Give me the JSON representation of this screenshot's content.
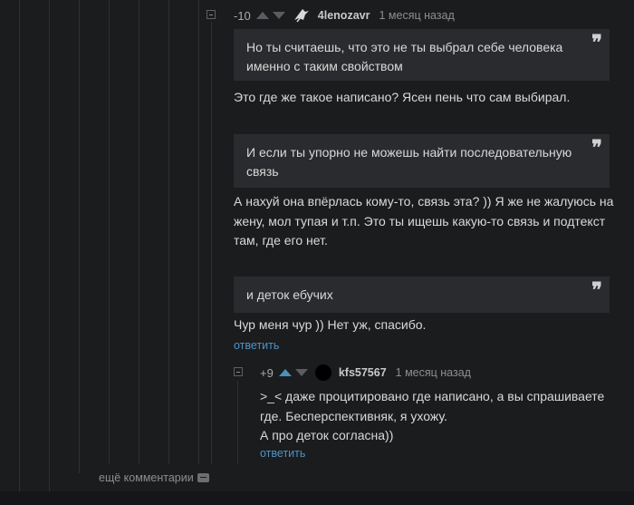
{
  "comment1": {
    "rating": "-10",
    "username": "4lenozavr",
    "date": "1 месяц назад",
    "quote1": "Но ты считаешь, что это не ты выбрал себе человека именно с таким свойством",
    "reply1": "Это где же такое написано? Ясен пень что сам выбирал.",
    "quote2": "И если ты упорно не можешь найти последовательную связь",
    "reply2": "А нахуй она впёрлась кому-то, связь эта? )) Я же не жалуюсь на жену, мол тупая и т.п. Это ты ищешь какую-то связь и подтекст там, где его нет.",
    "quote3": "и деток ебучих",
    "reply3": "Чур меня чур )) Нет уж, спасибо.",
    "reply_link": "ответить"
  },
  "comment2": {
    "rating": "+9",
    "username": "kfs57567",
    "date": "1 месяц назад",
    "line1": ">_< даже процитировано где написано, а вы спрашиваете",
    "line2": "где. Бесперспективняк, я ухожу.",
    "line3": "А про деток согласна))",
    "reply_link": "ответить"
  },
  "more_comments": "ещё комментарии",
  "quote_glyph": "❞",
  "colors": {
    "background": "#1b1c1e",
    "quote_bg": "#2a2b2e",
    "link": "#4e93c6",
    "upvote_active": "#4b8fbf"
  }
}
